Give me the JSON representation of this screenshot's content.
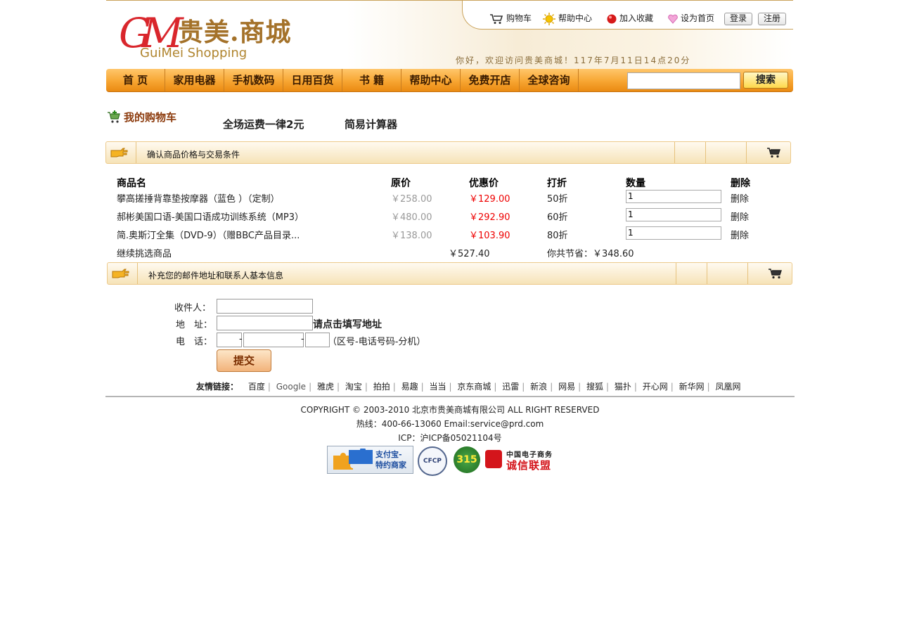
{
  "header": {
    "logo_letters": "GM",
    "logo_cn": "贵美.商城",
    "logo_en": "GuiMei Shopping",
    "top_links": [
      "购物车",
      "帮助中心",
      "加入收藏",
      "设为首页"
    ],
    "login": "登录",
    "register": "注册",
    "greeting": "你好，欢迎访问贵美商城！117年7月11日14点20分"
  },
  "nav": {
    "items": [
      "首 页",
      "家用电器",
      "手机数码",
      "日用百货",
      "书 籍",
      "帮助中心",
      "免费开店",
      "全球咨询"
    ],
    "search_placeholder": "",
    "search_button": "搜索"
  },
  "cart_bar": {
    "title": "我的购物车",
    "shipping_note": "全场运费一律2元",
    "calculator": "简易计算器"
  },
  "section1": {
    "label": "确认商品价格与交易条件"
  },
  "table": {
    "headers": [
      "商品名",
      "原价",
      "优惠价",
      "打折",
      "数量",
      "删除"
    ],
    "rows": [
      {
        "name": "攀高搓捶背靠垫按摩器（蓝色 ）（定制）",
        "orig": "￥258.00",
        "price": "￥129.00",
        "discount": "50折",
        "qty": "1",
        "del": "删除"
      },
      {
        "name": "郝彬美国口语-美国口语成功训练系统（MP3）",
        "orig": "￥480.00",
        "price": "￥292.90",
        "discount": "60折",
        "qty": "1",
        "del": "删除"
      },
      {
        "name": "简.奥斯汀全集（DVD-9）（赠BBC产品目录...",
        "orig": "￥138.00",
        "price": "￥103.90",
        "discount": "80折",
        "qty": "1",
        "del": "删除"
      }
    ],
    "continue": "继续挑选商品",
    "total": "￥527.40",
    "saved": "你共节省：￥348.60"
  },
  "section2": {
    "label": "补充您的邮件地址和联系人基本信息"
  },
  "form": {
    "recipient_label": "收件人：",
    "address_label": "地　址：",
    "address_hint": "请点击填写地址",
    "phone_label": "电　话：",
    "phone_hint": "（区号-电话号码-分机）",
    "dash": "-",
    "submit": "提交"
  },
  "friend_links": {
    "label": "友情链接：",
    "items": [
      "百度",
      "Google",
      "雅虎",
      "淘宝",
      "拍拍",
      "易趣",
      "当当",
      "京东商城",
      "迅雷",
      "新浪",
      "网易",
      "搜狐",
      "猫扑",
      "开心网",
      "新华网",
      "凤凰网"
    ]
  },
  "footer": {
    "copyright": "COPYRIGHT © 2003-2010 北京市贵美商城有限公司 ALL RIGHT RESERVED",
    "hotline": "热线：400-66-13060 Email:service@prd.com",
    "icp": "ICP：沪ICP备05021104号",
    "alipay_line1": "支付宝-",
    "alipay_line2": "特约商家",
    "badge_315": "315",
    "badge_cfcp": "CFCP",
    "cec_line1": "中国电子商务",
    "cec_line2": "诚信联盟"
  },
  "colors": {
    "nav_orange": "#f7a632",
    "price_red": "#ee0000",
    "brand_gold": "#a4722a",
    "logo_red": "#d9262c"
  }
}
